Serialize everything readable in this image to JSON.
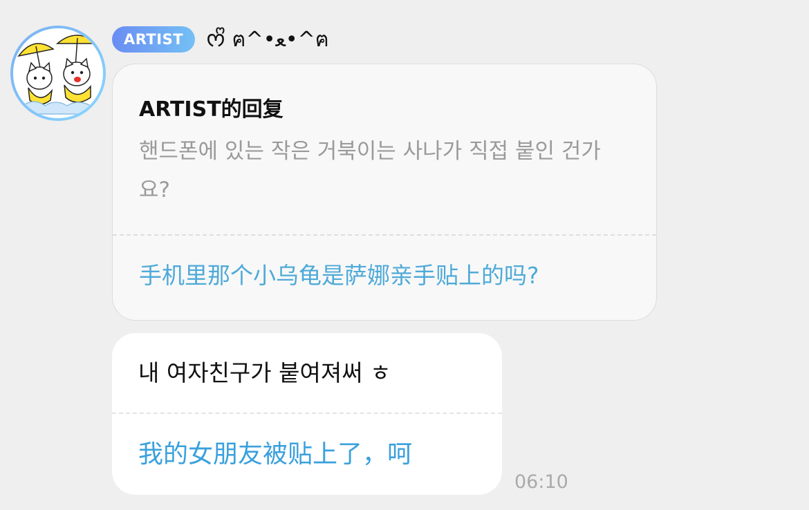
{
  "sender": {
    "avatar_icon": "cartoon-kittens-avatar-icon",
    "badge": "ARTIST",
    "name": "ᰔᩚ ฅ^•ﻌ•^ฅ"
  },
  "reply": {
    "title": "ARTIST的回复",
    "original_text": "핸드폰에 있는 작은 거북이는 사나가 직접 붙인 건가요?",
    "translation": "手机里那个小乌龟是萨娜亲手贴上的吗?"
  },
  "message": {
    "text": "내 여자친구가 붙여져써 ㅎ",
    "translation": "我的女朋友被贴上了，呵",
    "time": "06:10"
  },
  "colors": {
    "background": "#efefef",
    "badge_start": "#6a8df3",
    "badge_end": "#74c0f4",
    "translation": "#4eaad8",
    "muted_text": "#9a9a9a"
  }
}
